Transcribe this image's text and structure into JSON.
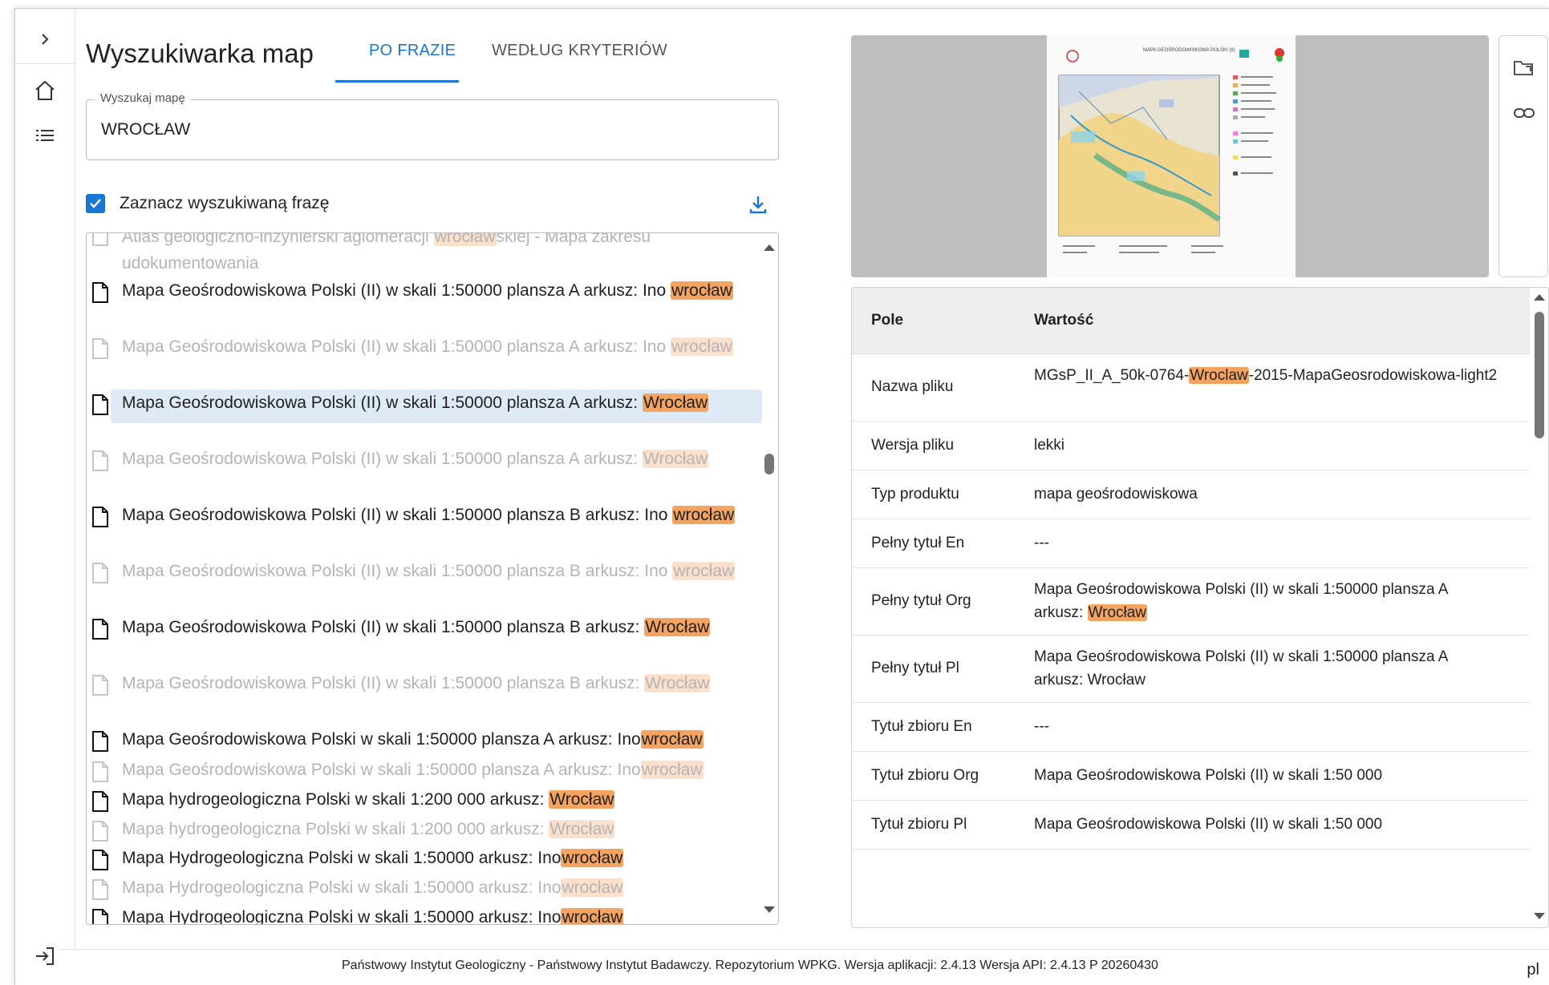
{
  "header": {
    "title": "Wyszukiwarka map",
    "tabs": [
      {
        "label": "PO FRAZIE",
        "active": true
      },
      {
        "label": "WEDŁUG KRYTERIÓW",
        "active": false
      }
    ]
  },
  "search": {
    "legend": "Wyszukaj mapę",
    "value": "WROCŁAW",
    "placeholder": ""
  },
  "highlight": {
    "checked": true,
    "label": "Zaznacz wyszukiwaną frazę"
  },
  "colors": {
    "accent": "#1976d2",
    "highlight": "#f4a460",
    "highlight_dim": "#fbe0cc",
    "selected_row": "#dfeaf7"
  },
  "results": [
    {
      "pre": "Atlas geologiczno-inżynierski aglomeracji ",
      "hl": "wrocław",
      "post": "skiej - Mapa zakresu udokumentowania",
      "dim": true
    },
    {
      "pre": "Mapa Geośrodowiskowa Polski (II) w skali 1:50000 plansza A arkusz: Ino ",
      "hl": "wrocław",
      "post": "",
      "dim": false
    },
    {
      "pre": "Mapa Geośrodowiskowa Polski (II) w skali 1:50000 plansza A arkusz: Ino ",
      "hl": "wrocław",
      "post": "",
      "dim": true
    },
    {
      "pre": "Mapa Geośrodowiskowa Polski (II) w skali 1:50000 plansza A arkusz: ",
      "hl": "Wrocław",
      "post": "",
      "dim": false,
      "selected": true
    },
    {
      "pre": "Mapa Geośrodowiskowa Polski (II) w skali 1:50000 plansza A arkusz: ",
      "hl": "Wrocław",
      "post": "",
      "dim": true
    },
    {
      "pre": "Mapa Geośrodowiskowa Polski (II) w skali 1:50000 plansza B arkusz: Ino ",
      "hl": "wrocław",
      "post": "",
      "dim": false
    },
    {
      "pre": "Mapa Geośrodowiskowa Polski (II) w skali 1:50000 plansza B arkusz: Ino ",
      "hl": "wrocław",
      "post": "",
      "dim": true
    },
    {
      "pre": "Mapa Geośrodowiskowa Polski (II) w skali 1:50000 plansza B arkusz: ",
      "hl": "Wrocław",
      "post": "",
      "dim": false
    },
    {
      "pre": "Mapa Geośrodowiskowa Polski (II) w skali 1:50000 plansza B arkusz: ",
      "hl": "Wrocław",
      "post": "",
      "dim": true
    },
    {
      "pre": "Mapa Geośrodowiskowa Polski w skali 1:50000 plansza A arkusz: Ino",
      "hl": "wrocław",
      "post": "",
      "dim": false
    },
    {
      "pre": "Mapa Geośrodowiskowa Polski w skali 1:50000 plansza A arkusz: Ino",
      "hl": "wrocław",
      "post": "",
      "dim": true
    },
    {
      "pre": "Mapa hydrogeologiczna Polski w skali 1:200 000 arkusz: ",
      "hl": "Wrocław",
      "post": "",
      "dim": false
    },
    {
      "pre": "Mapa hydrogeologiczna Polski w skali 1:200 000 arkusz: ",
      "hl": "Wrocław",
      "post": "",
      "dim": true
    },
    {
      "pre": "Mapa Hydrogeologiczna Polski w skali 1:50000 arkusz: Ino",
      "hl": "wrocław",
      "post": "",
      "dim": false
    },
    {
      "pre": "Mapa Hydrogeologiczna Polski w skali 1:50000 arkusz: Ino",
      "hl": "wrocław",
      "post": "",
      "dim": true
    },
    {
      "pre": "Mapa Hydrogeologiczna Polski w skali 1:50000 arkusz: Ino",
      "hl": "wrocław",
      "post": "",
      "dim": false
    }
  ],
  "preview": {
    "title": "MAPA GEOŚRODOWISKOWA POLSKI (II)"
  },
  "details": {
    "headers": [
      "Pole",
      "Wartość"
    ],
    "rows": [
      {
        "k": "Nazwa pliku",
        "pre": "MGsP_II_A_50k-0764-",
        "hl": "Wroclaw",
        "post": "-2015-MapaGeosrodowiskowa-light2"
      },
      {
        "k": "Wersja pliku",
        "pre": "lekki",
        "hl": "",
        "post": ""
      },
      {
        "k": "Typ produktu",
        "pre": "mapa geośrodowiskowa",
        "hl": "",
        "post": ""
      },
      {
        "k": "Pełny tytuł En",
        "pre": "---",
        "hl": "",
        "post": ""
      },
      {
        "k": "Pełny tytuł Org",
        "pre": "Mapa Geośrodowiskowa Polski (II) w skali 1:50000 plansza A arkusz: ",
        "hl": "Wrocław",
        "post": ""
      },
      {
        "k": "Pełny tytuł Pl",
        "pre": "Mapa Geośrodowiskowa Polski (II) w skali 1:50000 plansza A arkusz: Wrocław",
        "hl": "",
        "post": ""
      },
      {
        "k": "Tytuł zbioru En",
        "pre": "---",
        "hl": "",
        "post": ""
      },
      {
        "k": "Tytuł zbioru Org",
        "pre": "Mapa Geośrodowiskowa Polski (II) w skali 1:50 000",
        "hl": "",
        "post": ""
      },
      {
        "k": "Tytuł zbioru Pl",
        "pre": "Mapa Geośrodowiskowa Polski (II) w skali 1:50 000",
        "hl": "",
        "post": ""
      }
    ]
  },
  "footer": {
    "text": "Państwowy Instytut Geologiczny - Państwowy Instytut Badawczy. Repozytorium WPKG. Wersja aplikacji: 2.4.13 Wersja API: 2.4.13 P 20260430",
    "lang": "pl"
  },
  "icons": [
    "chevron-right-icon",
    "home-icon",
    "list-icon",
    "logout-icon",
    "check-icon",
    "download-icon",
    "file-icon",
    "folder-open-icon",
    "link-icon"
  ]
}
